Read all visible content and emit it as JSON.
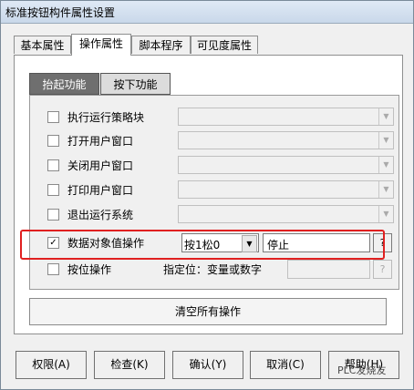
{
  "window": {
    "title": "标准按钮构件属性设置"
  },
  "tabs": [
    {
      "label": "基本属性"
    },
    {
      "label": "操作属性"
    },
    {
      "label": "脚本程序"
    },
    {
      "label": "可见度属性"
    }
  ],
  "subtabs": [
    {
      "label": "抬起功能"
    },
    {
      "label": "按下功能"
    }
  ],
  "rows": [
    {
      "label": "执行运行策略块",
      "checked": false
    },
    {
      "label": "打开用户窗口",
      "checked": false
    },
    {
      "label": "关闭用户窗口",
      "checked": false
    },
    {
      "label": "打印用户窗口",
      "checked": false
    },
    {
      "label": "退出运行系统",
      "checked": false
    },
    {
      "label": "数据对象值操作",
      "checked": true,
      "mode": "按1松0",
      "variable": "停止",
      "help": "?"
    },
    {
      "label": "按位操作",
      "checked": false,
      "hint": "指定位：变量或数字",
      "help": "?"
    }
  ],
  "clear_button": "清空所有操作",
  "buttons": {
    "permission": "权限(A)",
    "check": "检查(K)",
    "confirm": "确认(Y)",
    "cancel": "取消(C)",
    "help": "帮助(H)"
  },
  "watermark": "PLC发烧友",
  "icons": {
    "dropdown": "chevron-down-icon",
    "check": "checkmark-icon",
    "help": "question-icon"
  },
  "colors": {
    "highlight": "#e02020",
    "active_subtab": "#6f6f6f"
  }
}
